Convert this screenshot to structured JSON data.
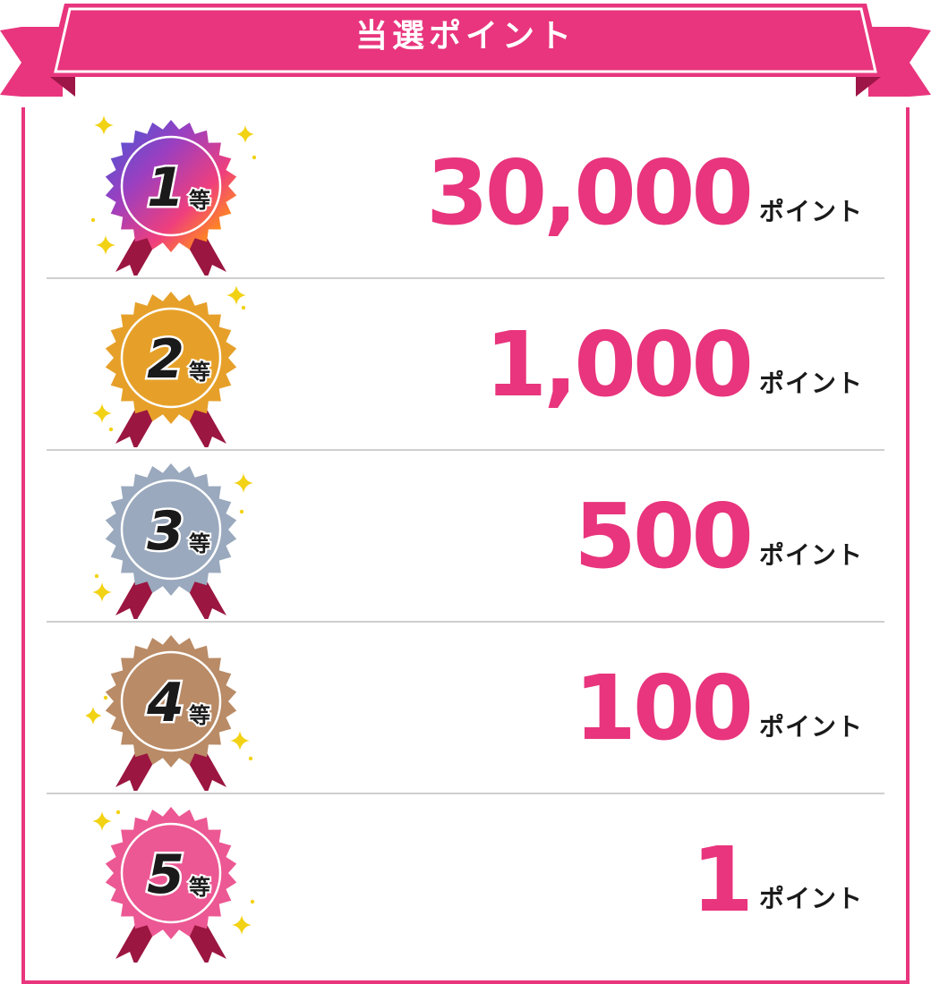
{
  "banner": {
    "title": "当選ポイント",
    "color": "#e8357d",
    "shadow_color": "#9e1547"
  },
  "accent_color": "#e8357d",
  "prizes": [
    {
      "rank": "1",
      "rank_suffix": "等",
      "points": "30,000",
      "unit": "ポイント",
      "medal_style": "gradient"
    },
    {
      "rank": "2",
      "rank_suffix": "等",
      "points": "1,000",
      "unit": "ポイント",
      "medal_color": "#e6a029"
    },
    {
      "rank": "3",
      "rank_suffix": "等",
      "points": "500",
      "unit": "ポイント",
      "medal_color": "#9aa9bd"
    },
    {
      "rank": "4",
      "rank_suffix": "等",
      "points": "100",
      "unit": "ポイント",
      "medal_color": "#b98b66"
    },
    {
      "rank": "5",
      "rank_suffix": "等",
      "points": "1",
      "unit": "ポイント",
      "medal_color": "#ec5893"
    }
  ],
  "ribbon_tail_color": "#9b1640",
  "sparkle_color": "#f2d214"
}
